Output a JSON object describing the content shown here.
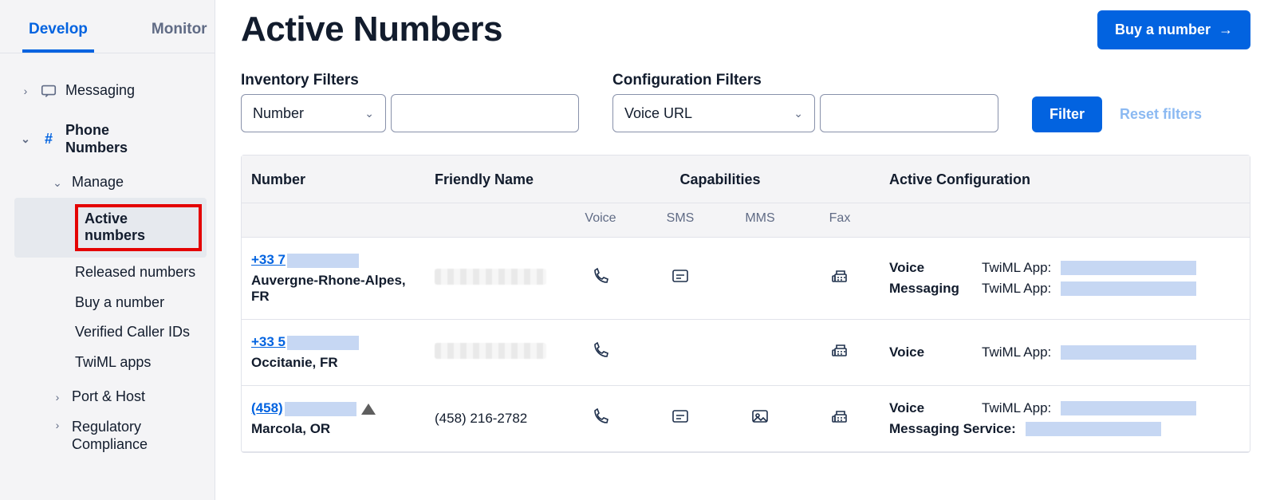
{
  "sidebar": {
    "tabs": {
      "develop": "Develop",
      "monitor": "Monitor"
    },
    "messaging": "Messaging",
    "phone_numbers": "Phone Numbers",
    "manage": {
      "label": "Manage",
      "items": [
        "Active numbers",
        "Released numbers",
        "Buy a number",
        "Verified Caller IDs",
        "TwiML apps"
      ]
    },
    "port_host": "Port & Host",
    "reg_comp": "Regulatory Compliance"
  },
  "header": {
    "title": "Active Numbers",
    "buy_button": "Buy a number"
  },
  "filters": {
    "inventory_label": "Inventory Filters",
    "inventory_select": "Number",
    "config_label": "Configuration Filters",
    "config_select": "Voice URL",
    "filter_btn": "Filter",
    "reset": "Reset filters"
  },
  "table": {
    "headers": {
      "number": "Number",
      "friendly": "Friendly Name",
      "capabilities": "Capabilities",
      "active_cfg": "Active Configuration"
    },
    "subheaders": {
      "voice": "Voice",
      "sms": "SMS",
      "mms": "MMS",
      "fax": "Fax"
    },
    "rows": [
      {
        "number_link": "+33 7",
        "location": "Auvergne-Rhone-Alpes, FR",
        "friendly_redacted": true,
        "caps": {
          "voice": true,
          "sms": true,
          "mms": false,
          "fax": true
        },
        "has_triangle": false,
        "config": [
          {
            "key": "Voice",
            "label": "TwiML App:"
          },
          {
            "key": "Messaging",
            "label": "TwiML App:"
          }
        ]
      },
      {
        "number_link": "+33 5",
        "location": "Occitanie, FR",
        "friendly_redacted": true,
        "caps": {
          "voice": true,
          "sms": false,
          "mms": false,
          "fax": true
        },
        "has_triangle": false,
        "config": [
          {
            "key": "Voice",
            "label": "TwiML App:"
          }
        ]
      },
      {
        "number_link": "(458)",
        "location": "Marcola, OR",
        "friendly_text": "(458) 216-2782",
        "friendly_redacted": false,
        "caps": {
          "voice": true,
          "sms": true,
          "mms": true,
          "fax": true
        },
        "has_triangle": true,
        "config": [
          {
            "key": "Voice",
            "label": "TwiML App:"
          },
          {
            "key": "Messaging Service:",
            "label": ""
          }
        ]
      }
    ]
  }
}
